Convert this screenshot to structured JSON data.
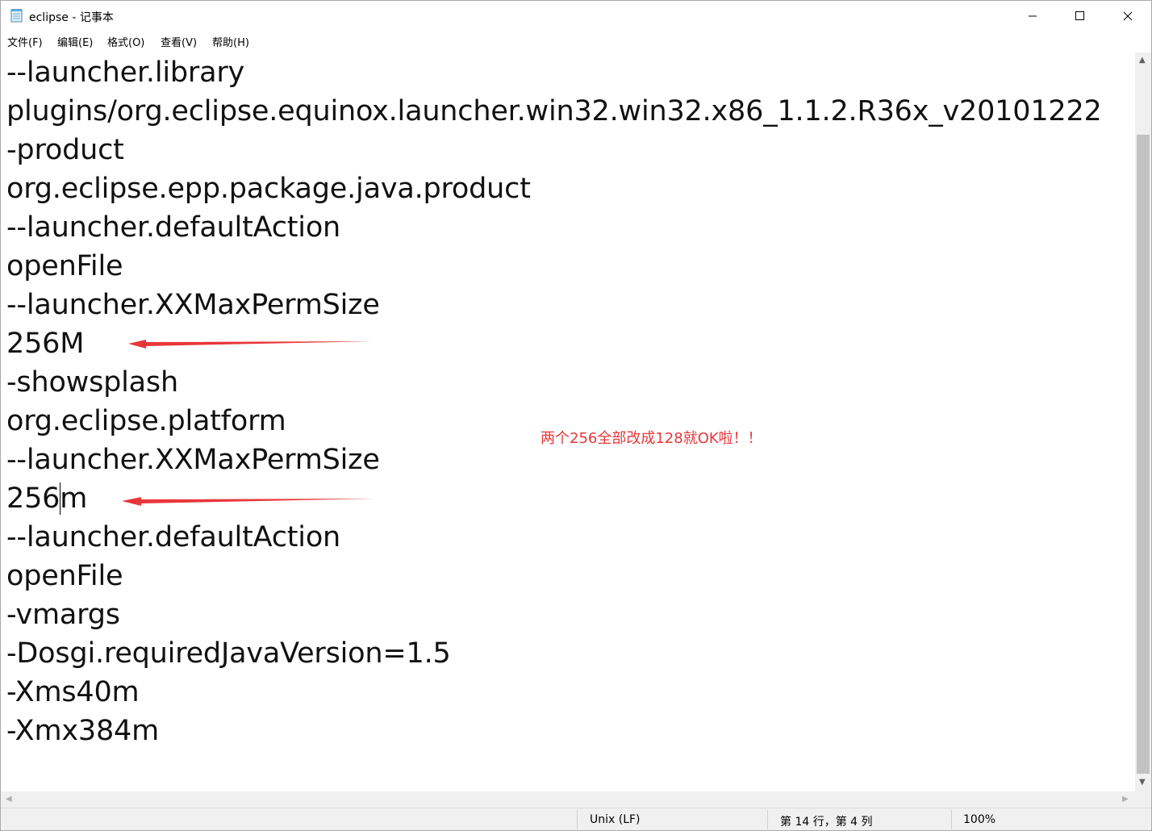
{
  "window": {
    "title": "eclipse - 记事本",
    "icon": "notepad-icon",
    "controls": {
      "minimize": "minimize-icon",
      "maximize": "maximize-icon",
      "close": "close-icon"
    }
  },
  "menu": [
    {
      "label": "文件(F)"
    },
    {
      "label": "编辑(E)"
    },
    {
      "label": "格式(O)"
    },
    {
      "label": "查看(V)"
    },
    {
      "label": "帮助(H)"
    }
  ],
  "editor": {
    "lines": [
      "--launcher.library",
      "plugins/org.eclipse.equinox.launcher.win32.win32.x86_1.1.2.R36x_v20101222",
      "-product",
      "org.eclipse.epp.package.java.product",
      "--launcher.defaultAction",
      "openFile",
      "--launcher.XXMaxPermSize",
      "256M",
      "-showsplash",
      "org.eclipse.platform",
      "--launcher.XXMaxPermSize",
      "256m",
      "--launcher.defaultAction",
      "openFile",
      "-vmargs",
      "-Dosgi.requiredJavaVersion=1.5",
      "-Xms40m",
      "-Xmx384m"
    ],
    "annotation": "两个256全部改成128就OK啦！！",
    "annotation_color": "#e8373a"
  },
  "status": {
    "line_ending": "Unix (LF)",
    "position": "第 14 行，第 4 列",
    "zoom": "100%"
  }
}
